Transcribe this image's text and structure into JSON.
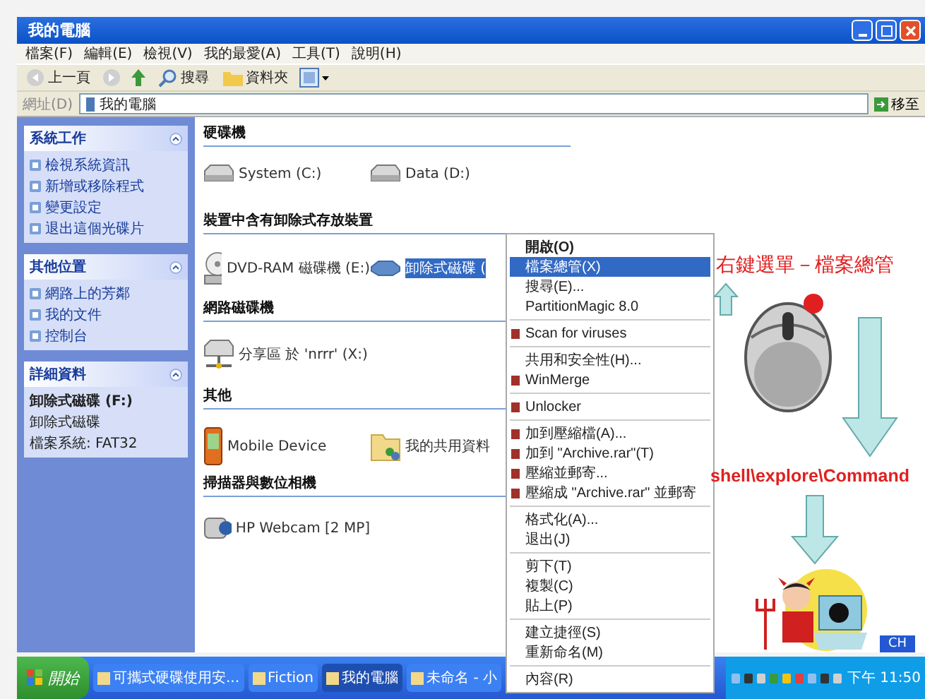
{
  "window": {
    "title": "我的電腦"
  },
  "menu": [
    "檔案(F)",
    "編輯(E)",
    "檢視(V)",
    "我的最愛(A)",
    "工具(T)",
    "說明(H)"
  ],
  "toolbar": {
    "back": "上一頁",
    "search": "搜尋",
    "folders": "資料夾"
  },
  "address": {
    "label": "網址(D)",
    "value": "我的電腦",
    "go": "移至"
  },
  "sidebar": [
    {
      "title": "系統工作",
      "items": [
        "檢視系統資訊",
        "新增或移除程式",
        "變更設定",
        "退出這個光碟片"
      ]
    },
    {
      "title": "其他位置",
      "items": [
        "網路上的芳鄰",
        "我的文件",
        "控制台"
      ]
    },
    {
      "title": "詳細資料",
      "details": [
        "卸除式磁碟 (F:)",
        "卸除式磁碟",
        "檔案系統: FAT32"
      ]
    }
  ],
  "groups": [
    {
      "title": "硬碟機",
      "items": [
        {
          "name": "System (C:)",
          "kind": "disk",
          "selected": false
        },
        {
          "name": "Data (D:)",
          "kind": "disk",
          "selected": false
        }
      ]
    },
    {
      "title": "裝置中含有卸除式存放裝置",
      "items": [
        {
          "name": "DVD-RAM 磁碟機 (E:)",
          "kind": "dvd",
          "selected": false
        },
        {
          "name": "卸除式磁碟 (",
          "kind": "removable",
          "selected": true
        }
      ]
    },
    {
      "title": "網路磁碟機",
      "items": [
        {
          "name": "分享區 於 'nrrr' (X:)",
          "kind": "network",
          "selected": false
        }
      ]
    },
    {
      "title": "其他",
      "items": [
        {
          "name": "Mobile Device",
          "kind": "phone",
          "selected": false
        },
        {
          "name": "我的共用資料",
          "kind": "folder",
          "selected": false
        }
      ]
    },
    {
      "title": "掃描器與數位相機",
      "items": [
        {
          "name": "HP Webcam [2 MP]",
          "kind": "camera",
          "selected": false
        }
      ]
    }
  ],
  "context_menu": [
    {
      "kind": "item",
      "label": "開啟(O)",
      "selected": false,
      "icon": false,
      "bold": true
    },
    {
      "kind": "item",
      "label": "檔案總管(X)",
      "selected": true,
      "icon": false,
      "bold": false
    },
    {
      "kind": "item",
      "label": "搜尋(E)...",
      "selected": false,
      "icon": false,
      "bold": false
    },
    {
      "kind": "item",
      "label": "PartitionMagic 8.0",
      "selected": false,
      "icon": false,
      "bold": false
    },
    {
      "kind": "separator"
    },
    {
      "kind": "item",
      "label": "Scan for viruses",
      "selected": false,
      "icon": true,
      "bold": false
    },
    {
      "kind": "separator"
    },
    {
      "kind": "item",
      "label": "共用和安全性(H)...",
      "selected": false,
      "icon": false,
      "bold": false
    },
    {
      "kind": "item",
      "label": "WinMerge",
      "selected": false,
      "icon": true,
      "bold": false
    },
    {
      "kind": "separator"
    },
    {
      "kind": "item",
      "label": "Unlocker",
      "selected": false,
      "icon": true,
      "bold": false
    },
    {
      "kind": "separator"
    },
    {
      "kind": "item",
      "label": "加到壓縮檔(A)...",
      "selected": false,
      "icon": true,
      "bold": false
    },
    {
      "kind": "item",
      "label": "加到 \"Archive.rar\"(T)",
      "selected": false,
      "icon": true,
      "bold": false
    },
    {
      "kind": "item",
      "label": "壓縮並郵寄...",
      "selected": false,
      "icon": true,
      "bold": false
    },
    {
      "kind": "item",
      "label": "壓縮成 \"Archive.rar\" 並郵寄",
      "selected": false,
      "icon": true,
      "bold": false
    },
    {
      "kind": "separator"
    },
    {
      "kind": "item",
      "label": "格式化(A)...",
      "selected": false,
      "icon": false,
      "bold": false
    },
    {
      "kind": "item",
      "label": "退出(J)",
      "selected": false,
      "icon": false,
      "bold": false
    },
    {
      "kind": "separator"
    },
    {
      "kind": "item",
      "label": "剪下(T)",
      "selected": false,
      "icon": false,
      "bold": false
    },
    {
      "kind": "item",
      "label": "複製(C)",
      "selected": false,
      "icon": false,
      "bold": false
    },
    {
      "kind": "item",
      "label": "貼上(P)",
      "selected": false,
      "icon": false,
      "bold": false
    },
    {
      "kind": "separator"
    },
    {
      "kind": "item",
      "label": "建立捷徑(S)",
      "selected": false,
      "icon": false,
      "bold": false
    },
    {
      "kind": "item",
      "label": "重新命名(M)",
      "selected": false,
      "icon": false,
      "bold": false
    },
    {
      "kind": "separator"
    },
    {
      "kind": "item",
      "label": "內容(R)",
      "selected": false,
      "icon": false,
      "bold": false
    }
  ],
  "annotations": {
    "menu_caption": "右鍵選單－檔案總管",
    "registry_path": "shell\\explore\\Command"
  },
  "taskbar": {
    "start": "開始",
    "tasks": [
      {
        "label": "可攜式硬碟使用安...",
        "selected": false
      },
      {
        "label": "Fiction",
        "selected": false
      },
      {
        "label": "我的電腦",
        "selected": true
      },
      {
        "label": "未命名 - 小",
        "selected": false
      }
    ],
    "language": "CH",
    "clock": "下午 11:50"
  }
}
